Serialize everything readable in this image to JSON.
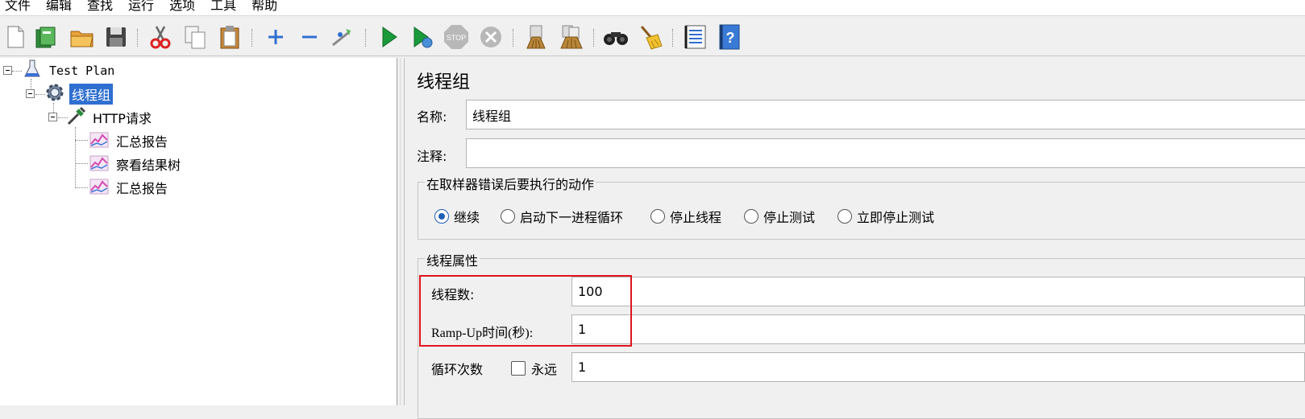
{
  "menu": [
    "文件",
    "编辑",
    "查找",
    "运行",
    "选项",
    "工具",
    "帮助"
  ],
  "toolbar": {
    "icons": [
      "new-icon",
      "templates-icon",
      "open-icon",
      "save-icon",
      "cut-icon",
      "copy-icon",
      "paste-icon",
      "expand-icon",
      "collapse-icon",
      "toggle-icon",
      "start-icon",
      "start-no-pause-icon",
      "stop-icon",
      "shutdown-icon",
      "clear-icon",
      "clear-all-icon",
      "search-icon",
      "reset-search-icon",
      "function-helper-icon",
      "help-icon"
    ],
    "colors": {
      "play": "#1a9a3a",
      "disabled": "#b8b8b8",
      "blue": "#2f6fd0"
    }
  },
  "tree": {
    "test_plan": "Test Plan",
    "thread_group": "线程组",
    "http_request": "HTTP请求",
    "listeners": [
      "汇总报告",
      "察看结果树",
      "汇总报告"
    ]
  },
  "panel": {
    "title": "线程组",
    "name_label": "名称:",
    "name_value": "线程组",
    "comment_label": "注释:",
    "comment_value": "",
    "error_action": {
      "legend": "在取样器错误后要执行的动作",
      "options": [
        "继续",
        "启动下一进程循环",
        "停止线程",
        "停止测试",
        "立即停止测试"
      ],
      "selected": "继续"
    },
    "thread_props": {
      "legend": "线程属性",
      "threads_label": "线程数:",
      "threads_value": "100",
      "rampup_label": "Ramp-Up时间(秒):",
      "rampup_value": "1",
      "loop_label": "循环次数",
      "forever_label": "永远",
      "loop_value": "1"
    },
    "highlight_color": "#e0141e"
  }
}
